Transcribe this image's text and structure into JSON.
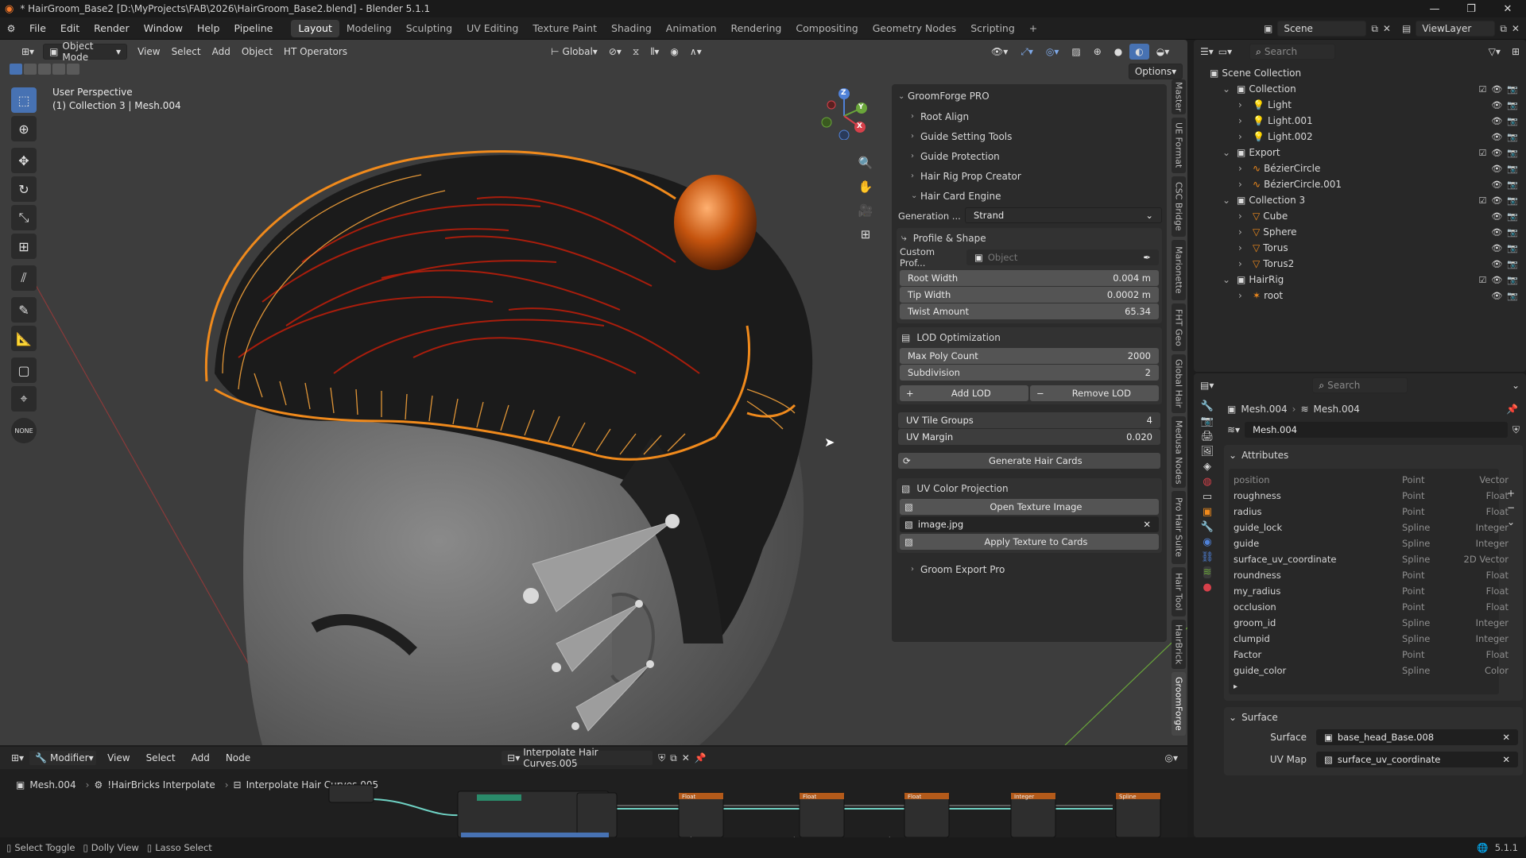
{
  "titlebar": {
    "title": "* HairGroom_Base2 [D:\\MyProjects\\FAB\\2026\\HairGroom_Base2.blend] - Blender 5.1.1"
  },
  "menubar": {
    "menus": [
      "File",
      "Edit",
      "Render",
      "Window",
      "Help",
      "Pipeline"
    ],
    "workspaces": [
      "Layout",
      "Modeling",
      "Sculpting",
      "UV Editing",
      "Texture Paint",
      "Shading",
      "Animation",
      "Rendering",
      "Compositing",
      "Geometry Nodes",
      "Scripting"
    ],
    "active_workspace": "Layout",
    "scene": "Scene",
    "view_layer": "ViewLayer"
  },
  "viewport": {
    "mode": "Object Mode",
    "menus": [
      "View",
      "Select",
      "Add",
      "Object",
      "HT Operators"
    ],
    "transform_orientation": "Global",
    "options_label": "Options",
    "overlay_title": "User Perspective",
    "overlay_sub": "(1) Collection 3 | Mesh.004",
    "gizmo_axes": [
      "Z",
      "Y",
      "X"
    ],
    "colors": {
      "bg": "#3d3d3d",
      "hair_orange": "#f08a1c",
      "hair_red": "#c21e0a",
      "skin": "#6b6b6b"
    }
  },
  "npanel": {
    "addon": "GroomForge PRO",
    "subpanels": [
      "Root Align",
      "Guide Setting Tools",
      "Guide Protection",
      "Hair Rig Prop Creator",
      "Hair Card Engine"
    ],
    "generation_label": "Generation ...",
    "generation_value": "Strand",
    "profile_shape": "Profile & Shape",
    "custom_profile_label": "Custom Prof...",
    "custom_profile_placeholder": "Object",
    "root_width": {
      "label": "Root Width",
      "value": "0.004 m"
    },
    "tip_width": {
      "label": "Tip Width",
      "value": "0.0002 m"
    },
    "twist_amount": {
      "label": "Twist Amount",
      "value": "65.34"
    },
    "lod_title": "LOD Optimization",
    "max_poly": {
      "label": "Max Poly Count",
      "value": "2000"
    },
    "subdivision": {
      "label": "Subdivision",
      "value": "2"
    },
    "add_lod": "Add LOD",
    "remove_lod": "Remove LOD",
    "uv_tile_groups": {
      "label": "UV Tile Groups",
      "value": "4"
    },
    "uv_margin": {
      "label": "UV Margin",
      "value": "0.020"
    },
    "generate_cards": "Generate Hair Cards",
    "uv_projection_title": "UV Color Projection",
    "open_texture": "Open Texture Image",
    "image_name": "image.jpg",
    "apply_texture": "Apply Texture to Cards",
    "export": "Groom Export Pro",
    "tabs": [
      "Master",
      "UE Format",
      "CSC Bridge",
      "Marionette",
      "FHT Geo",
      "Global Hair",
      "Medusa Nodes",
      "Pro Hair Suite",
      "Hair Tool",
      "HairBrick",
      "GroomForge"
    ]
  },
  "outliner": {
    "search_placeholder": "Search",
    "root": "Scene Collection",
    "items": [
      {
        "name": "Collection",
        "level": 0,
        "type": "collection"
      },
      {
        "name": "Light",
        "level": 1,
        "type": "light"
      },
      {
        "name": "Light.001",
        "level": 1,
        "type": "light"
      },
      {
        "name": "Light.002",
        "level": 1,
        "type": "light"
      },
      {
        "name": "Export",
        "level": 0,
        "type": "collection"
      },
      {
        "name": "BézierCircle",
        "level": 1,
        "type": "curve"
      },
      {
        "name": "BézierCircle.001",
        "level": 1,
        "type": "curve"
      },
      {
        "name": "Collection 3",
        "level": 0,
        "type": "collection"
      },
      {
        "name": "Cube",
        "level": 1,
        "type": "mesh"
      },
      {
        "name": "Sphere",
        "level": 1,
        "type": "mesh"
      },
      {
        "name": "Torus",
        "level": 1,
        "type": "mesh"
      },
      {
        "name": "Torus2",
        "level": 1,
        "type": "mesh"
      },
      {
        "name": "HairRig",
        "level": 0,
        "type": "collection"
      },
      {
        "name": "root",
        "level": 1,
        "type": "armature"
      }
    ]
  },
  "properties": {
    "search_placeholder": "Search",
    "breadcrumb": [
      "Mesh.004",
      "Mesh.004"
    ],
    "data_name": "Mesh.004",
    "attributes_title": "Attributes",
    "attributes": [
      {
        "name": "position",
        "domain": "Point",
        "type": "Vector"
      },
      {
        "name": "roughness",
        "domain": "Point",
        "type": "Float"
      },
      {
        "name": "radius",
        "domain": "Point",
        "type": "Float"
      },
      {
        "name": "guide_lock",
        "domain": "Spline",
        "type": "Integer"
      },
      {
        "name": "guide",
        "domain": "Spline",
        "type": "Integer"
      },
      {
        "name": "surface_uv_coordinate",
        "domain": "Spline",
        "type": "2D Vector"
      },
      {
        "name": "roundness",
        "domain": "Point",
        "type": "Float"
      },
      {
        "name": "my_radius",
        "domain": "Point",
        "type": "Float"
      },
      {
        "name": "occlusion",
        "domain": "Point",
        "type": "Float"
      },
      {
        "name": "groom_id",
        "domain": "Spline",
        "type": "Integer"
      },
      {
        "name": "clumpid",
        "domain": "Spline",
        "type": "Integer"
      },
      {
        "name": "Factor",
        "domain": "Point",
        "type": "Float"
      },
      {
        "name": "guide_color",
        "domain": "Spline",
        "type": "Color"
      }
    ],
    "surface_title": "Surface",
    "surface_label": "Surface",
    "surface_value": "base_head_Base.008",
    "uvmap_label": "UV Map",
    "uvmap_value": "surface_uv_coordinate"
  },
  "nodeeditor": {
    "editor_type": "Modifier",
    "menus": [
      "View",
      "Select",
      "Add",
      "Node"
    ],
    "node_group": "Interpolate Hair Curves.005",
    "breadcrumb": [
      "Mesh.004",
      "!HairBricks Interpolate",
      "Interpolate Hair Curves.005"
    ],
    "node_labels": [
      "Float",
      "Float",
      "Float",
      "Integer",
      "Spline"
    ]
  },
  "statusbar": {
    "left": [
      "Select Toggle",
      "Dolly View",
      "Lasso Select"
    ],
    "version": "5.1.1"
  }
}
